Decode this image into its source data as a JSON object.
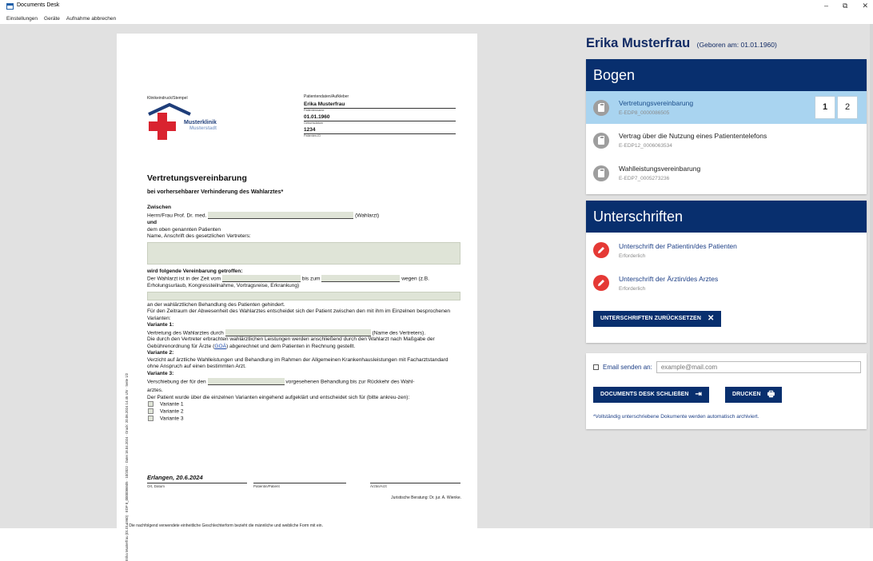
{
  "app": {
    "title": "Documents Desk"
  },
  "window_controls": {
    "minimize": "–",
    "restore": "⧉",
    "close": "✕"
  },
  "menu": [
    "Einstellungen",
    "Geräte",
    "Aufnahme abbrechen"
  ],
  "document": {
    "clinic_stamp_label": "Klinikeindruck/Stempel",
    "clinic_name_line1": "Musterklinik",
    "clinic_name_line2": "Musterstadt",
    "patient_data_label": "Patientendaten/Aufkleber",
    "patient_name": "Erika Musterfrau",
    "patient_name_label": "Patientenname",
    "patient_dob": "01.01.1960",
    "patient_dob_label": "Geburtsdatum",
    "patient_id": "1234",
    "patient_id_label": "Patienten-ID",
    "title": "Vertretungsvereinbarung",
    "subtitle": "bei vorhersehbarer Verhinderung des Wahlarztes*",
    "between": "Zwischen",
    "herr_frau": "Herrn/Frau Prof. Dr. med.",
    "wahlarzt": "(Wahlarzt)",
    "und": "und",
    "patient_line": "dem oben genannten Patienten",
    "address_line": "Name, Anschrift des gesetzlichen Vertreters:",
    "agreement": "wird folgende Vereinbarung getroffen:",
    "period_prefix": "Der Wahlarzt ist in der Zeit vom",
    "period_mid": "bis zum",
    "period_suffix": "wegen (z.B.",
    "reason_examples": "Erholungsurlaub, Kongressteilnahme, Vortragsreise, Erkrankung)",
    "prevented": "an der wahlärztlichen Behandlung des Patienten gehindert.",
    "absence_text": "Für den Zeitraum der Abwesenheit des Wahlarztes entscheidet sich der Patient zwischen den mit ihm im Einzelnen besprochenen Varianten:",
    "variant1_title": "Variante 1:",
    "variant1_prefix": "Vertretung des Wahlarztes durch",
    "variant1_suffix": "(Name des Vertreters).",
    "variant1_text": "Die durch den Vertreter erbrachten wahlärztlichen Leistungen werden anschließend durch den Wahlarzt nach Maßgabe der Gebührenordnung für Ärzte (",
    "goa": "GOÄ",
    "variant1_text_end": ") abgerechnet und dem Patienten in Rechnung gestellt.",
    "variant2_title": "Variante 2:",
    "variant2_text": "Verzicht auf ärztliche Wahlleistungen und Behandlung im Rahmen der Allgemeinen Krankenhausleistungen mit Facharztstandard ohne Anspruch auf einen bestimmten Arzt.",
    "variant3_title": "Variante 3:",
    "variant3_prefix": "Verschiebung der für den",
    "variant3_suffix": "vorgesehenen Behandlung bis zur Rückkehr des Wahl-",
    "variant3_end": "arztes.",
    "decision_text": "Der Patient wurde über die einzelnen Varianten eingehend aufgeklärt und entscheidet sich für (bitte ankreu-zen):",
    "check1": "Variante 1",
    "check2": "Variante 2",
    "check3": "Variante 3",
    "place_date": "Erlangen,   20.6.2024",
    "sig_label1": "Ort, Datum",
    "sig_label2": "Patientin/Patient",
    "sig_label3": "Ärztin/Arzt",
    "legal_advice": "Juristische Beratung: Dr. jur. A. Wienke.",
    "footnote": "*  Die nachfolgend verwendete einheitliche Geschlechterform bezieht die männliche und weibliche Form mit ein.",
    "side_text": "Erika Musterfrau (01.01.1960) · EDP 8_0000086505 · 10/2022 · Datei 18.04.2024 · Druck: 20.06.2024 14:45 Uhr · Seite 1/2"
  },
  "patient": {
    "name": "Erika Musterfrau",
    "dob_text": "(Geboren am: 01.01.1960)"
  },
  "bogen": {
    "header": "Bogen",
    "items": [
      {
        "title": "Vertretungsvereinbarung",
        "code": "E-EDP8_0000086505",
        "active": true
      },
      {
        "title": "Vertrag über die Nutzung eines Patiententelefons",
        "code": "E-EDP12_0006063534"
      },
      {
        "title": "Wahlleistungsvereinbarung",
        "code": "E-EDP7_0005273236"
      }
    ],
    "pages": [
      "1",
      "2"
    ],
    "current_page": "1"
  },
  "signatures": {
    "header": "Unterschriften",
    "items": [
      {
        "title": "Unterschrift der Patientin/des Patienten",
        "status": "Erforderlich"
      },
      {
        "title": "Unterschrift der Ärztin/des Arztes",
        "status": "Erforderlich"
      }
    ],
    "reset_label": "UNTERSCHRIFTEN ZURÜCKSETZEN",
    "reset_icon": "✕"
  },
  "actions": {
    "email_label": "Email senden an:",
    "email_placeholder": "example@mail.com",
    "close_label": "DOCUMENTS DESK SCHLIEßEN",
    "close_icon": "⇥",
    "print_label": "DRUCKEN",
    "print_icon": "🖶",
    "archive_note": "*Vollständig unterschriebene Dokumente werden automatisch archiviert."
  },
  "colors": {
    "primary": "#082f6e",
    "active_item": "#a9d4f0",
    "danger": "#e53935",
    "field": "#dfe4d7"
  }
}
